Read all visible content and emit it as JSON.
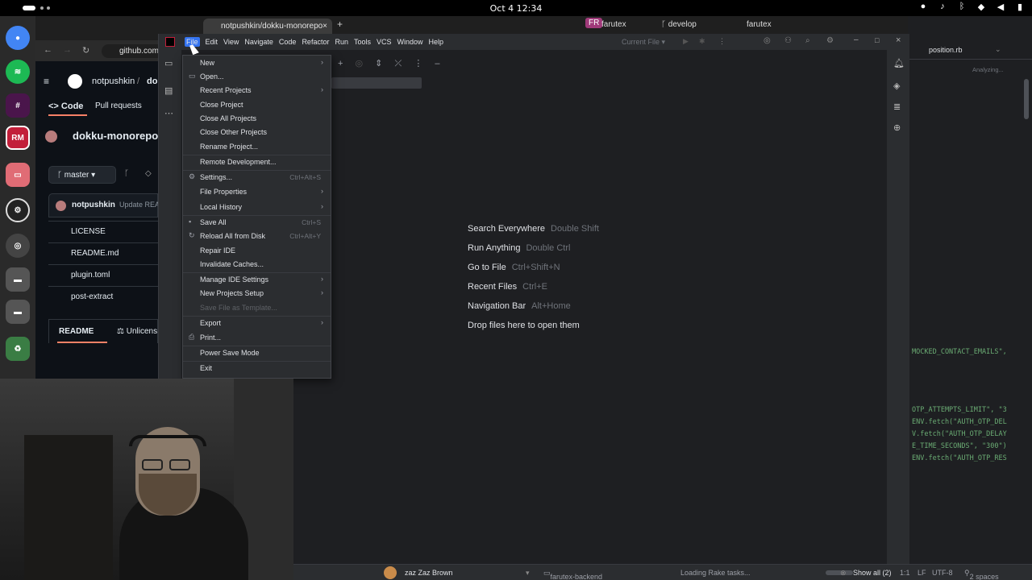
{
  "topbar": {
    "clock": "Oct 4  12:34"
  },
  "browser": {
    "tab_title": "notpushkin/dokku-monorepo",
    "url": "github.com",
    "owner": "notpushkin",
    "repo_short": "do",
    "nav_code": "Code",
    "nav_pulls": "Pull requests",
    "repo_name": "dokku-monorepo",
    "branch": "master",
    "commit_author": "notpushkin",
    "commit_msg": "Update REA",
    "files": [
      "LICENSE",
      "README.md",
      "plugin.toml",
      "post-extract"
    ],
    "readme_tab": "README",
    "license_tab": "Unlicens"
  },
  "ide": {
    "menubar": [
      "File",
      "Edit",
      "View",
      "Navigate",
      "Code",
      "Refactor",
      "Run",
      "Tools",
      "VCS",
      "Window",
      "Help"
    ],
    "current_file": "Current File",
    "hints": [
      {
        "label": "Search Everywhere",
        "key": "Double Shift"
      },
      {
        "label": "Run Anything",
        "key": "Double Ctrl"
      },
      {
        "label": "Go to File",
        "key": "Ctrl+Shift+N"
      },
      {
        "label": "Recent Files",
        "key": "Ctrl+E"
      },
      {
        "label": "Navigation Bar",
        "key": "Alt+Home"
      },
      {
        "label": "Drop files here to open them",
        "key": ""
      }
    ]
  },
  "file_menu": {
    "items": [
      {
        "label": "New",
        "shortcut": "",
        "submenu": true,
        "icon": ""
      },
      {
        "label": "Open...",
        "shortcut": "",
        "submenu": false,
        "icon": "folder-icon"
      },
      {
        "label": "Recent Projects",
        "shortcut": "",
        "submenu": true,
        "icon": ""
      },
      {
        "label": "Close Project",
        "shortcut": "",
        "submenu": false,
        "icon": ""
      },
      {
        "label": "Close All Projects",
        "shortcut": "",
        "submenu": false,
        "icon": ""
      },
      {
        "label": "Close Other Projects",
        "shortcut": "",
        "submenu": false,
        "icon": ""
      },
      {
        "label": "Rename Project...",
        "shortcut": "",
        "submenu": false,
        "icon": ""
      },
      {
        "label": "Remote Development...",
        "shortcut": "",
        "submenu": false,
        "icon": ""
      },
      {
        "label": "Settings...",
        "shortcut": "Ctrl+Alt+S",
        "submenu": false,
        "icon": "gear-icon"
      },
      {
        "label": "File Properties",
        "shortcut": "",
        "submenu": true,
        "icon": ""
      },
      {
        "label": "Local History",
        "shortcut": "",
        "submenu": true,
        "icon": ""
      },
      {
        "label": "Save All",
        "shortcut": "Ctrl+S",
        "submenu": false,
        "icon": "save-icon"
      },
      {
        "label": "Reload All from Disk",
        "shortcut": "Ctrl+Alt+Y",
        "submenu": false,
        "icon": "reload-icon"
      },
      {
        "label": "Repair IDE",
        "shortcut": "",
        "submenu": false,
        "icon": ""
      },
      {
        "label": "Invalidate Caches...",
        "shortcut": "",
        "submenu": false,
        "icon": ""
      },
      {
        "label": "Manage IDE Settings",
        "shortcut": "",
        "submenu": true,
        "icon": ""
      },
      {
        "label": "New Projects Setup",
        "shortcut": "",
        "submenu": true,
        "icon": ""
      },
      {
        "label": "Save File as Template...",
        "shortcut": "",
        "submenu": false,
        "icon": "",
        "disabled": true
      },
      {
        "label": "Export",
        "shortcut": "",
        "submenu": true,
        "icon": ""
      },
      {
        "label": "Print...",
        "shortcut": "",
        "submenu": false,
        "icon": "print-icon"
      },
      {
        "label": "Power Save Mode",
        "shortcut": "",
        "submenu": false,
        "icon": ""
      },
      {
        "label": "Exit",
        "shortcut": "",
        "submenu": false,
        "icon": ""
      }
    ]
  },
  "editor2": {
    "tab_title": "position.rb",
    "analyzing": "Analyzing...",
    "window_titles": [
      "farutex",
      "develop",
      "farutex"
    ],
    "code_lines": [
      "MOCKED_CONTACT_EMAILS\",",
      "OTP_ATTEMPTS_LIMIT\", \"3",
      "ENV.fetch(\"AUTH_OTP_DEL",
      "V.fetch(\"AUTH_OTP_DELAY",
      "E_TIME_SECONDS\", \"300\")",
      "ENV.fetch(\"AUTH_OTP_RES"
    ]
  },
  "status": {
    "user": "zaz  Zaz Brown",
    "project": "farutex-backend",
    "task": "Loading Rake tasks...",
    "show_all": "Show all (2)",
    "position": "1:1",
    "line_sep": "LF",
    "encoding": "UTF-8",
    "indent": "2 spaces"
  }
}
